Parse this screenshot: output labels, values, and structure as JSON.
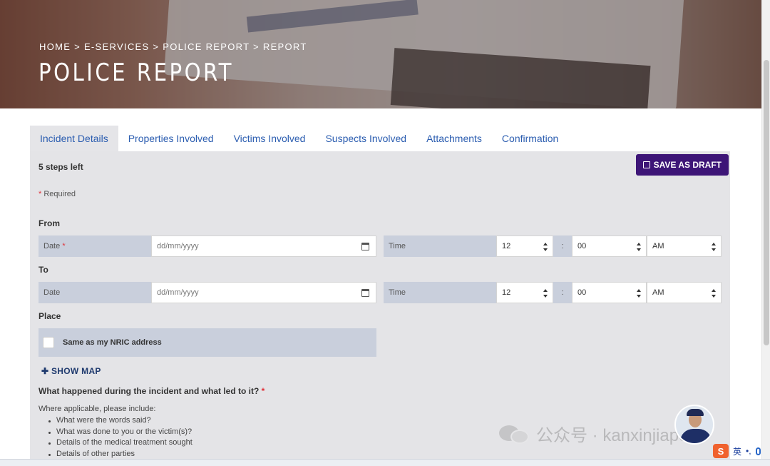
{
  "header": {
    "breadcrumb": [
      "HOME",
      "E-SERVICES",
      "POLICE REPORT",
      "REPORT"
    ],
    "separator": ">",
    "title": "POLICE REPORT"
  },
  "tabs": [
    {
      "label": "Incident Details",
      "active": true
    },
    {
      "label": "Properties Involved",
      "active": false
    },
    {
      "label": "Victims Involved",
      "active": false
    },
    {
      "label": "Suspects Involved",
      "active": false
    },
    {
      "label": "Attachments",
      "active": false
    },
    {
      "label": "Confirmation",
      "active": false
    }
  ],
  "form": {
    "steps_left": "5 steps left",
    "save_draft_label": "SAVE AS DRAFT",
    "required_note": "Required",
    "required_mark": "*",
    "from": {
      "label": "From",
      "date_label": "Date",
      "date_placeholder": "dd/mm/yyyy",
      "time_label": "Time",
      "hour": "12",
      "colon": ":",
      "minute": "00",
      "ampm": "AM"
    },
    "to": {
      "label": "To",
      "date_label": "Date",
      "date_placeholder": "dd/mm/yyyy",
      "time_label": "Time",
      "hour": "12",
      "colon": ":",
      "minute": "00",
      "ampm": "AM"
    },
    "place": {
      "label": "Place",
      "same_as_nric": "Same as my NRIC address",
      "show_map": "SHOW MAP"
    },
    "incident": {
      "question": "What happened during the incident and what led to it?",
      "helper": "Where applicable, please include:",
      "items": [
        "What were the words said?",
        "What was done to you or the victim(s)?",
        "Details of the medical treatment sought",
        "Details of other parties"
      ]
    }
  },
  "overlay": {
    "watermark": "公众号 · kanxinjiapo",
    "ime_label": "英",
    "ime_logo": "S",
    "ime_punct": "•,"
  },
  "colors": {
    "accent": "#3d1577",
    "tab_link": "#2b5db0",
    "label_bg": "#c9cfdc",
    "form_bg": "#e4e4e7",
    "required": "#e0323a"
  }
}
